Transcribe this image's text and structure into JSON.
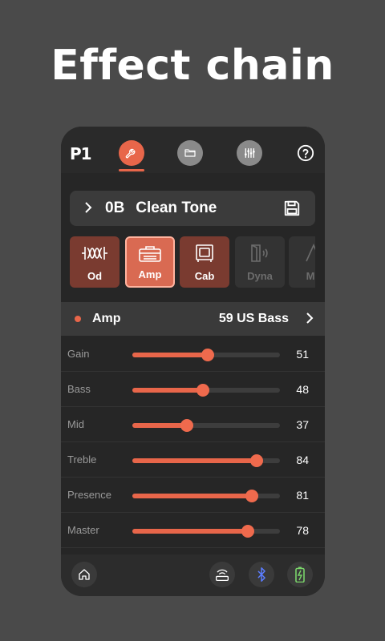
{
  "headline": "Effect chain",
  "nav": {
    "logo": "P1",
    "items": [
      "wrench-icon",
      "folder-icon",
      "mixer-icon",
      "help-icon"
    ],
    "active": "wrench-icon"
  },
  "preset": {
    "number": "0B",
    "name": "Clean Tone"
  },
  "blocks": [
    {
      "label": "Od",
      "state": "on"
    },
    {
      "label": "Amp",
      "state": "selected"
    },
    {
      "label": "Cab",
      "state": "on"
    },
    {
      "label": "Dyna",
      "state": "off"
    },
    {
      "label": "Mo",
      "state": "off"
    }
  ],
  "amp": {
    "title": "Amp",
    "model": "59 US Bass"
  },
  "params": [
    {
      "name": "Gain",
      "value": "51",
      "level": 51
    },
    {
      "name": "Bass",
      "value": "48",
      "level": 48
    },
    {
      "name": "Mid",
      "value": "37",
      "level": 37
    },
    {
      "name": "Treble",
      "value": "84",
      "level": 84
    },
    {
      "name": "Presence",
      "value": "81",
      "level": 81
    },
    {
      "name": "Master",
      "value": "78",
      "level": 78
    }
  ],
  "colors": {
    "accent": "#e8664a",
    "background": "#4a4a4a",
    "panel": "#262626"
  }
}
